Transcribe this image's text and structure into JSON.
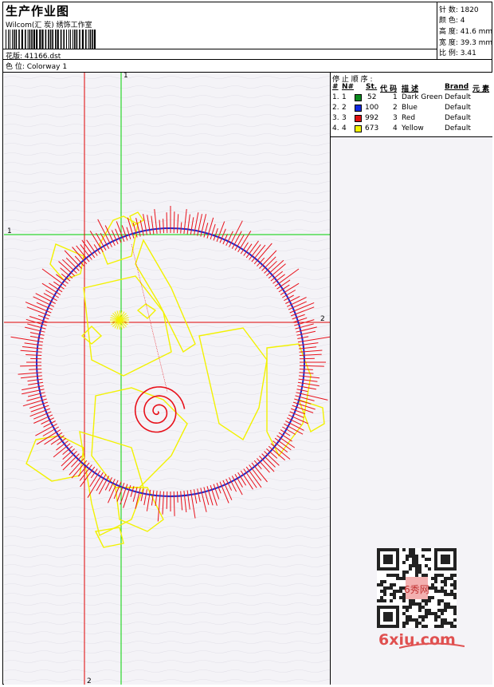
{
  "header": {
    "title": "生产作业图",
    "company": "Wilcom(汇 炭) 绣饰工作室",
    "design_label": "花版: 41166.dst",
    "colorway_label": "色 位:  Colorway 1"
  },
  "specs": {
    "stitches": "针 数:  1820",
    "colors": "颜 色:  4",
    "height": "高 度:  41.6 mm",
    "width": "宽 度:  39.3 mm",
    "ratio": "比 例:  3.41"
  },
  "stop_sequence": {
    "title": "停 止 顺 序 :",
    "columns": [
      "#",
      "N#",
      "St.",
      "代 码",
      "描 述",
      "Brand",
      "元 素"
    ],
    "rows": [
      {
        "num": "1.",
        "n": "1",
        "stitches": "52",
        "code": "1",
        "desc": "Dark Green",
        "brand": "Default",
        "color": "#0a8a1e"
      },
      {
        "num": "2.",
        "n": "2",
        "stitches": "100",
        "code": "2",
        "desc": "Blue",
        "brand": "Default",
        "color": "#1028e0"
      },
      {
        "num": "3.",
        "n": "3",
        "stitches": "992",
        "code": "3",
        "desc": "Red",
        "brand": "Default",
        "color": "#e01010"
      },
      {
        "num": "4.",
        "n": "4",
        "stitches": "673",
        "code": "4",
        "desc": "Yellow",
        "brand": "Default",
        "color": "#f4f400"
      }
    ]
  },
  "canvas": {
    "axis_labels": {
      "green_top": "1",
      "green_left": "1",
      "red_right": "2",
      "red_bottom": "2"
    }
  },
  "watermark": {
    "site": "6xiu.com",
    "qr_label": "6秀网"
  },
  "colors": {
    "guide_green": "#00d000",
    "guide_red": "#e00000",
    "thread_red": "#e8101a",
    "thread_yellow": "#f2f200",
    "thread_blue": "#1a2ad0"
  }
}
